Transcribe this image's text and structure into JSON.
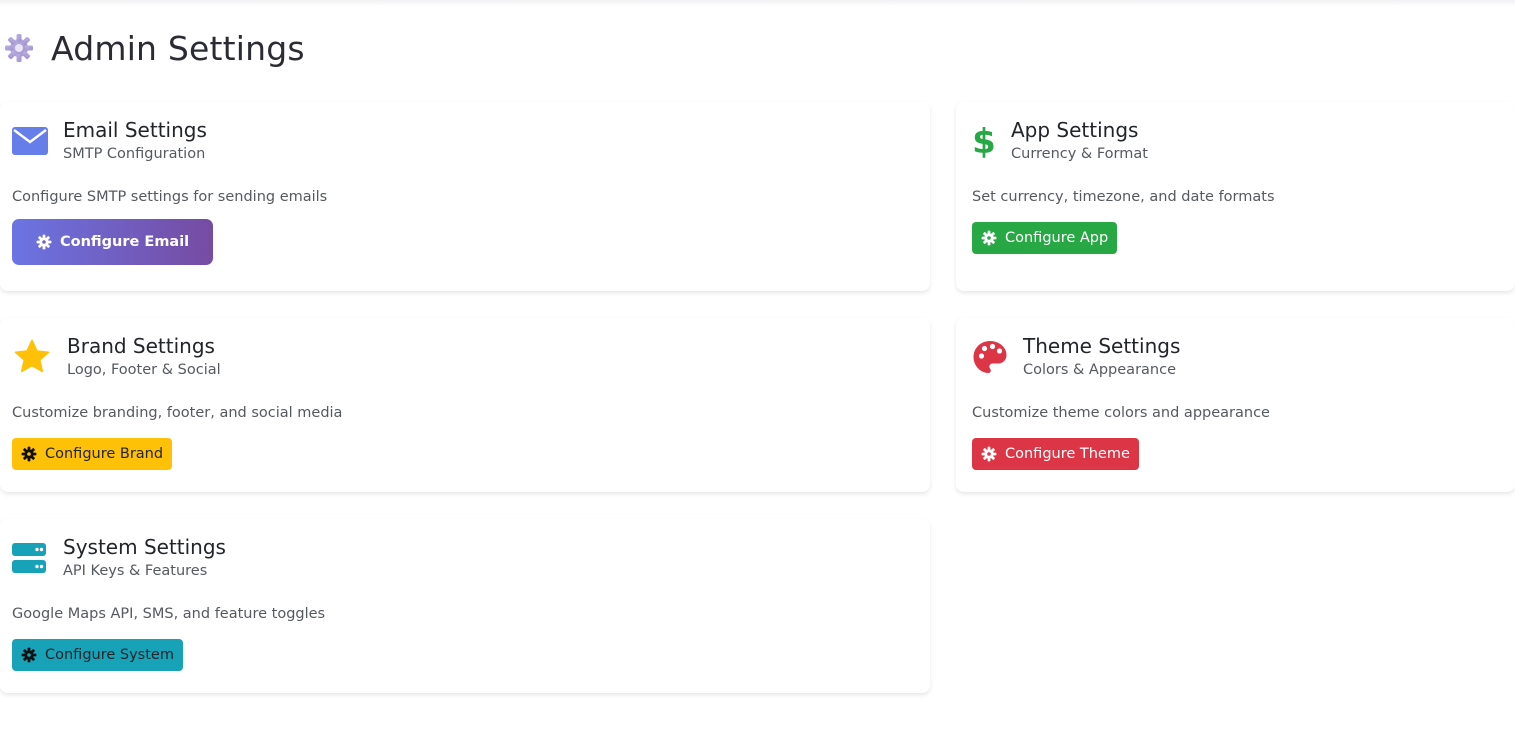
{
  "page": {
    "title": "Admin Settings"
  },
  "colors": {
    "email": "#667eea",
    "app": "#28a745",
    "brand": "#ffc107",
    "theme": "#dc3545",
    "system": "#17a2b8"
  },
  "cards": {
    "email": {
      "icon": "envelope-icon",
      "title": "Email Settings",
      "subtitle": "SMTP Configuration",
      "description": "Configure SMTP settings for sending emails",
      "button": "Configure Email"
    },
    "app": {
      "icon": "dollar-icon",
      "title": "App Settings",
      "subtitle": "Currency & Format",
      "description": "Set currency, timezone, and date formats",
      "button": "Configure App"
    },
    "brand": {
      "icon": "star-icon",
      "title": "Brand Settings",
      "subtitle": "Logo, Footer & Social",
      "description": "Customize branding, footer, and social media",
      "button": "Configure Brand"
    },
    "theme": {
      "icon": "palette-icon",
      "title": "Theme Settings",
      "subtitle": "Colors & Appearance",
      "description": "Customize theme colors and appearance",
      "button": "Configure Theme"
    },
    "system": {
      "icon": "server-icon",
      "title": "System Settings",
      "subtitle": "API Keys & Features",
      "description": "Google Maps API, SMS, and feature toggles",
      "button": "Configure System"
    }
  }
}
